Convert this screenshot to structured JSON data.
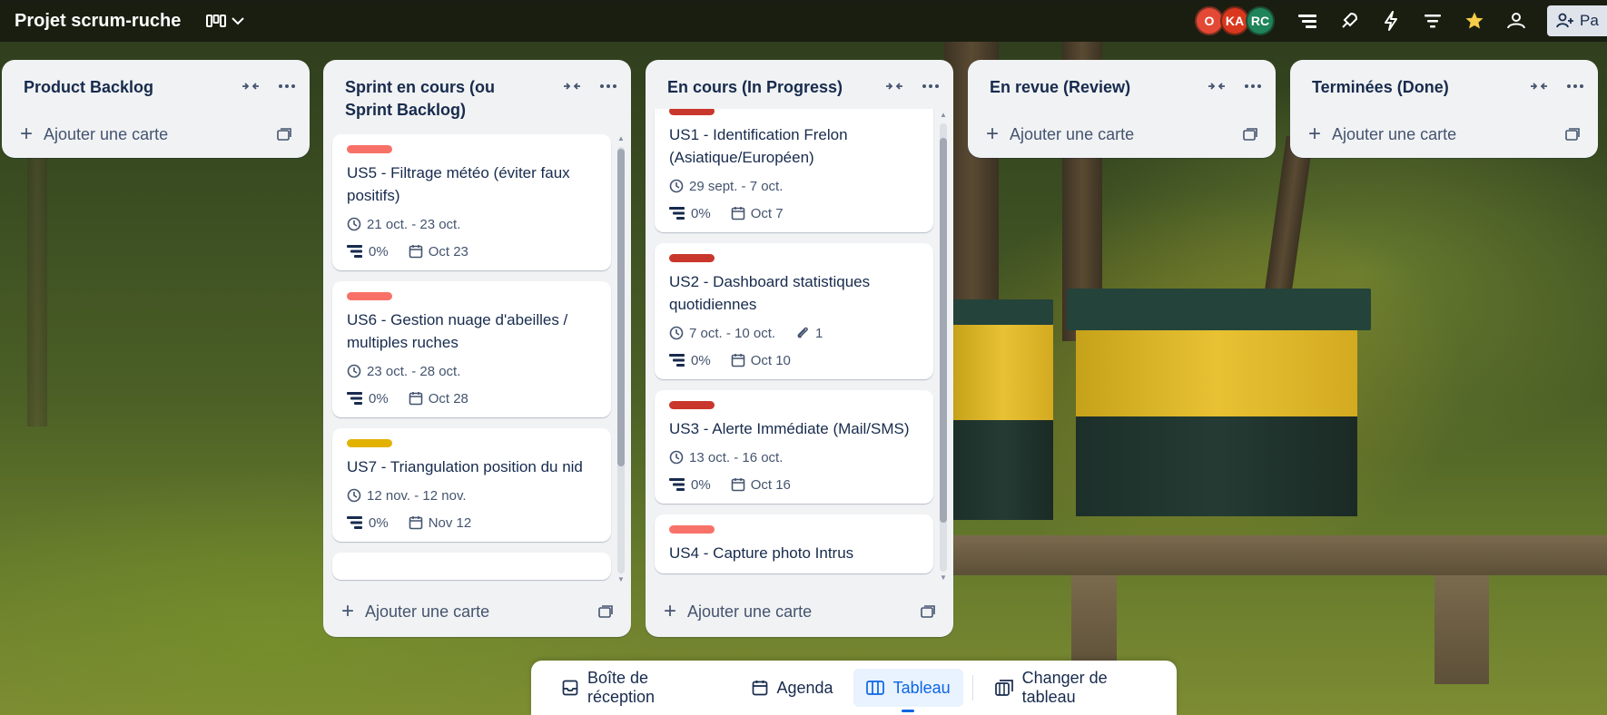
{
  "header": {
    "board_title": "Projet scrum-ruche",
    "avatars": [
      {
        "initials": "O",
        "color": "#e34935"
      },
      {
        "initials": "KA",
        "color": "#d9381e"
      },
      {
        "initials": "RC",
        "color": "#1f845a"
      }
    ],
    "share_label": "Pa"
  },
  "lists": [
    {
      "title": "Product Backlog",
      "add_label": "Ajouter une carte",
      "cards": []
    },
    {
      "title": "Sprint en cours (ou Sprint Backlog)",
      "add_label": "Ajouter une carte",
      "cards": [
        {
          "label_color": "#f87168",
          "title": "US5 - Filtrage météo (éviter faux positifs)",
          "dates": "21 oct. - 23 oct.",
          "progress": "0%",
          "due": "Oct 23"
        },
        {
          "label_color": "#f87168",
          "title": "US6 - Gestion nuage d'abeilles / multiples ruches",
          "dates": "23 oct. - 28 oct.",
          "progress": "0%",
          "due": "Oct 28"
        },
        {
          "label_color": "#e2b203",
          "title": "US7 - Triangulation position du nid",
          "dates": "12 nov. - 12 nov.",
          "progress": "0%",
          "due": "Nov 12"
        }
      ]
    },
    {
      "title": "En cours (In Progress)",
      "add_label": "Ajouter une carte",
      "cards": [
        {
          "label_color": "#c9372c",
          "title": "US1 - Identification Frelon (Asiatique/Européen)",
          "dates": "29 sept. - 7 oct.",
          "progress": "0%",
          "due": "Oct 7"
        },
        {
          "label_color": "#c9372c",
          "title": "US2 - Dashboard statistiques quotidiennes",
          "dates": "7 oct. - 10 oct.",
          "attachments": "1",
          "progress": "0%",
          "due": "Oct 10"
        },
        {
          "label_color": "#c9372c",
          "title": "US3 - Alerte Immédiate (Mail/SMS)",
          "dates": "13 oct. - 16 oct.",
          "progress": "0%",
          "due": "Oct 16"
        },
        {
          "label_color": "#f87168",
          "title": "US4 - Capture photo Intrus"
        }
      ]
    },
    {
      "title": "En revue (Review)",
      "add_label": "Ajouter une carte",
      "cards": []
    },
    {
      "title": "Terminées (Done)",
      "add_label": "Ajouter une carte",
      "cards": []
    }
  ],
  "bottom_nav": {
    "inbox": "Boîte de réception",
    "agenda": "Agenda",
    "board": "Tableau",
    "switch": "Changer de tableau"
  }
}
